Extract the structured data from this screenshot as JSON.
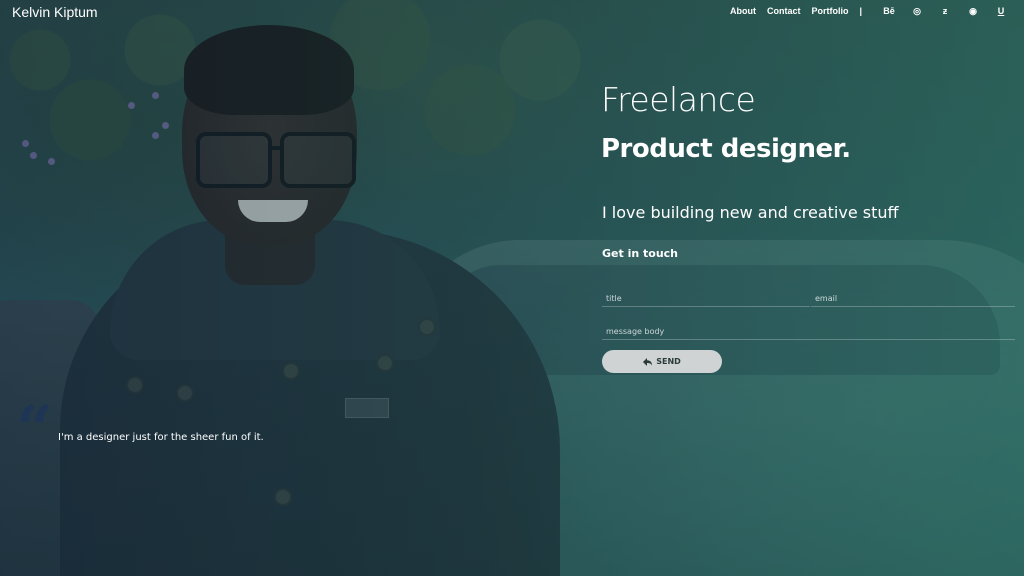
{
  "brand": "Kelvin Kiptum",
  "nav": {
    "links": [
      "About",
      "Contact",
      "Portfolio"
    ],
    "separator": "|",
    "social_icons": [
      "behance-icon",
      "dribbble-icon",
      "deviantart-icon",
      "pinterest-icon",
      "underline-u-icon"
    ],
    "icon_glyphs": [
      "Bē",
      "◎",
      "ƶ",
      "◉",
      "U"
    ]
  },
  "hero": {
    "line1": "Freelance",
    "line2": "Product designer.",
    "tagline": "I love building new and creative stuff",
    "get_in_touch": "Get in touch"
  },
  "form": {
    "title_placeholder": "title",
    "email_placeholder": "email",
    "message_placeholder": "message body",
    "send_label": "SEND",
    "send_icon": "reply-arrow-icon"
  },
  "quote": {
    "mark": "“",
    "text": "I'm a designer just for the sheer fun of it."
  },
  "colors": {
    "overlay_start": "#0f2846",
    "overlay_end": "#286e64",
    "button_bg": "#cfd3d3",
    "quote_mark": "#1e3555"
  }
}
